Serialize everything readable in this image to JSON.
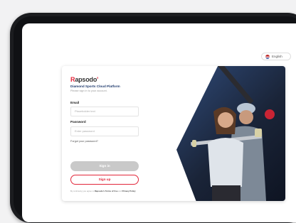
{
  "language": {
    "label": "English",
    "icon": "us-flag-icon"
  },
  "brand": {
    "logo_text_accent": "R",
    "logo_text_rest": "apsodo",
    "logo_mark": "'",
    "accent_color": "#e2263a"
  },
  "login": {
    "title": "Diamond Sports Cloud Platform",
    "hint": "Please sign in to your account.",
    "email_label": "Email",
    "email_placeholder": "Placeholder text",
    "password_label": "Password",
    "password_placeholder": "Enter password",
    "forgot_label": "Forgot your password?",
    "signin_label": "Sign in",
    "signup_label": "Sign up",
    "terms_prefix": "By continuing you agree to ",
    "terms_link": "Rapsodo's Terms of Use",
    "terms_and": " and ",
    "privacy_link": "Privacy Policy"
  }
}
